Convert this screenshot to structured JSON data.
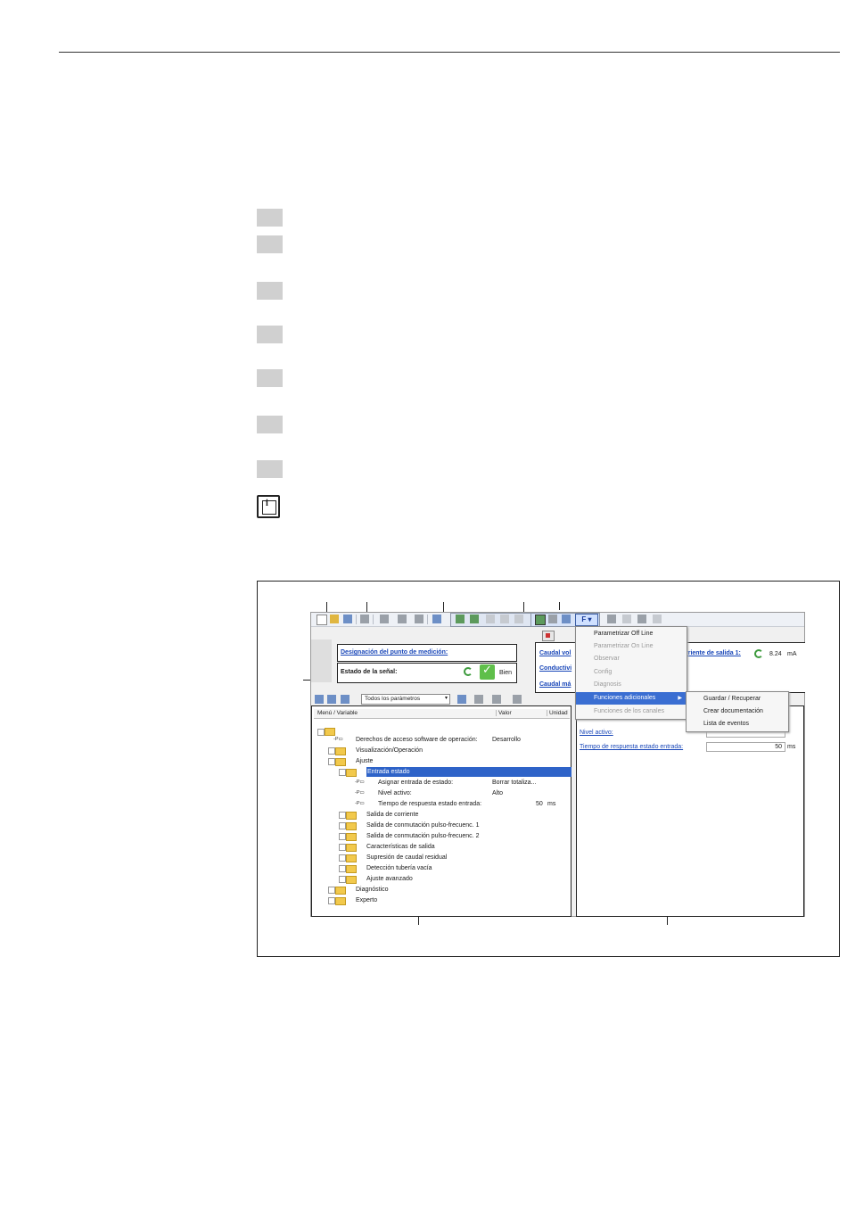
{
  "app": {
    "measuring_point_label": "Designación del punto de medición:",
    "signal_status_label": "Estado de la señal:",
    "signal_status_value": "Bien",
    "process_value_1": "Caudal vol",
    "process_value_2": "Conductivi",
    "process_value_3": "Caudal má",
    "output_current_label": "rriente de salida 1:",
    "output_current_value": "8.24",
    "output_current_unit": "mA",
    "filter_select": "Todos los parámetros",
    "fbutton": "F"
  },
  "tree": {
    "columns": [
      "Menú / Variable",
      "Valor",
      "Unidad"
    ],
    "rows": [
      {
        "label": "Derechos de acceso software de operación:",
        "value": "Desarrollo",
        "unit": ""
      },
      {
        "label": "Visualización/Operación",
        "value": "",
        "unit": ""
      },
      {
        "label": "Ajuste",
        "value": "",
        "unit": ""
      },
      {
        "label": "Entrada estado",
        "value": "",
        "unit": ""
      },
      {
        "label": "Asignar entrada de estado:",
        "value": "Borrar totaliza...",
        "unit": ""
      },
      {
        "label": "Nivel activo:",
        "value": "Alto",
        "unit": ""
      },
      {
        "label": "Tiempo de respuesta estado entrada:",
        "value": "50",
        "unit": "ms"
      },
      {
        "label": "Salida de corriente",
        "value": "",
        "unit": ""
      },
      {
        "label": "Salida de conmutación pulso-frecuenc. 1",
        "value": "",
        "unit": ""
      },
      {
        "label": "Salida de conmutación pulso-frecuenc. 2",
        "value": "",
        "unit": ""
      },
      {
        "label": "Características de salida",
        "value": "",
        "unit": ""
      },
      {
        "label": "Supresión de caudal residual",
        "value": "",
        "unit": ""
      },
      {
        "label": "Detección tubería vacía",
        "value": "",
        "unit": ""
      },
      {
        "label": "Ajuste avanzado",
        "value": "",
        "unit": ""
      },
      {
        "label": "Diagnóstico",
        "value": "",
        "unit": ""
      },
      {
        "label": "Experto",
        "value": "",
        "unit": ""
      }
    ]
  },
  "right_panel": {
    "nivel_label": "Nivel activo:",
    "tiempo_label": "Tiempo de respuesta estado entrada:",
    "tiempo_value": "50",
    "tiempo_unit": "ms"
  },
  "menu": {
    "items": [
      {
        "label": "Parametrizar Off Line",
        "state": "normal"
      },
      {
        "label": "Parametrizar On Line",
        "state": "disabled"
      },
      {
        "label": "Observar",
        "state": "disabled"
      },
      {
        "label": "Config",
        "state": "disabled"
      },
      {
        "label": "Diagnosis",
        "state": "disabled"
      },
      {
        "label": "Funciones adicionales",
        "state": "highlighted"
      },
      {
        "label": "Funciones de los canales",
        "state": "disabled"
      }
    ],
    "submenu": [
      "Guardar / Recuperar",
      "Crear documentación",
      "Lista de eventos"
    ]
  }
}
